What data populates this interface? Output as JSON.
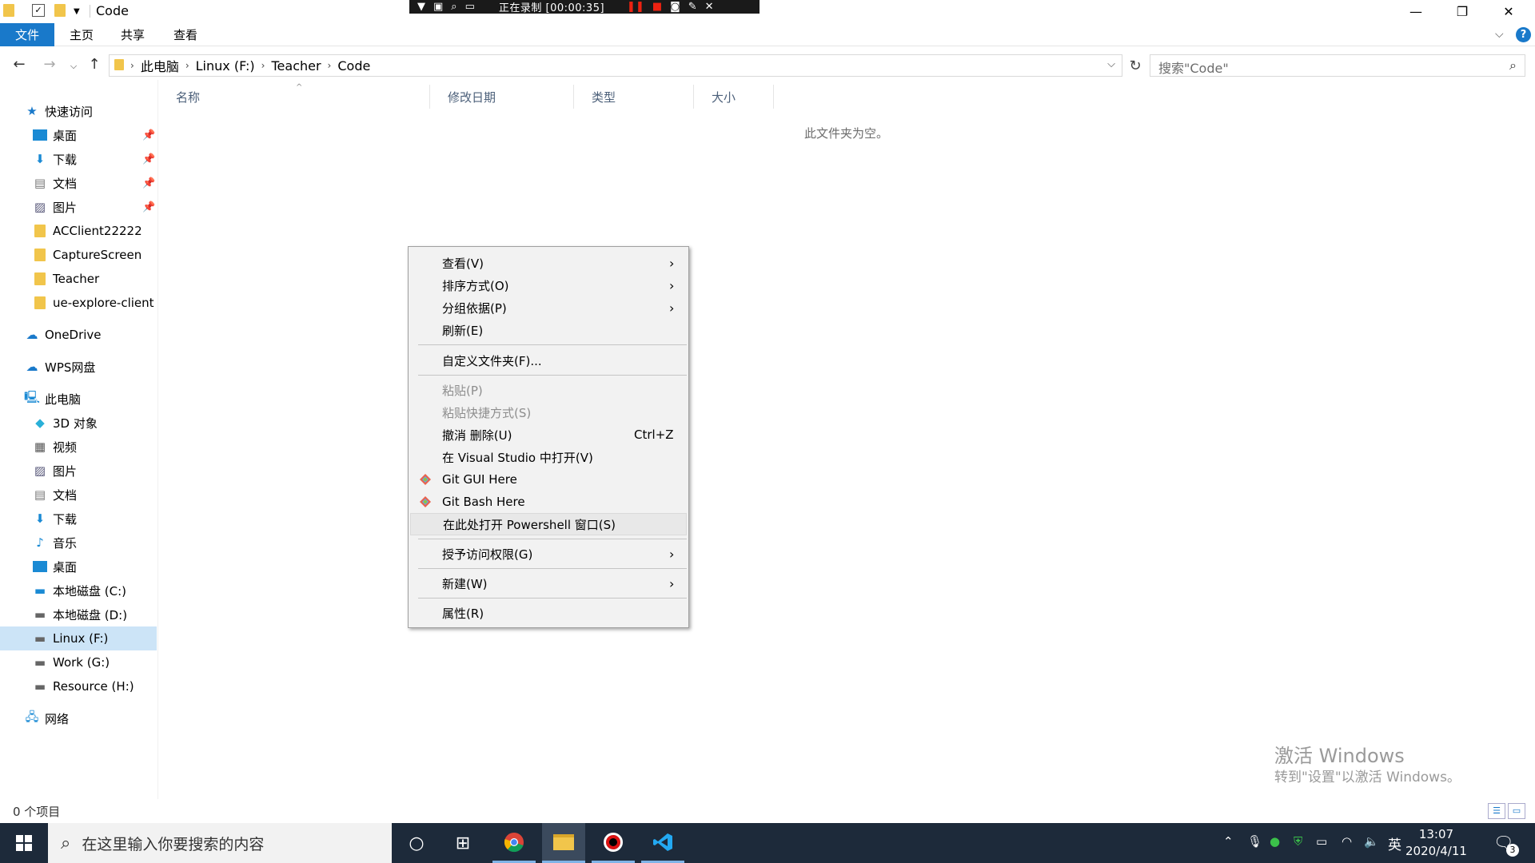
{
  "window": {
    "title": "Code",
    "minimize_label": "—",
    "restore_label": "❐",
    "close_label": "✕"
  },
  "recording_bar": {
    "text": "正在录制 [00:00:35]"
  },
  "ribbon": {
    "tabs": [
      "文件",
      "主页",
      "共享",
      "查看"
    ]
  },
  "address": {
    "crumbs": [
      "此电脑",
      "Linux (F:)",
      "Teacher",
      "Code"
    ],
    "search_placeholder": "搜索\"Code\""
  },
  "sidebar": {
    "quick_access": "快速访问",
    "quick_items": [
      {
        "label": "桌面",
        "pinned": true
      },
      {
        "label": "下载",
        "pinned": true
      },
      {
        "label": "文档",
        "pinned": true
      },
      {
        "label": "图片",
        "pinned": true
      },
      {
        "label": "ACClient22222",
        "pinned": false
      },
      {
        "label": "CaptureScreen",
        "pinned": false
      },
      {
        "label": "Teacher",
        "pinned": false
      },
      {
        "label": "ue-explore-client",
        "pinned": false
      }
    ],
    "onedrive": "OneDrive",
    "wps": "WPS网盘",
    "this_pc": "此电脑",
    "pc_items": [
      "3D 对象",
      "视频",
      "图片",
      "文档",
      "下载",
      "音乐",
      "桌面",
      "本地磁盘 (C:)",
      "本地磁盘 (D:)",
      "Linux (F:)",
      "Work (G:)",
      "Resource (H:)"
    ],
    "selected": "Linux (F:)",
    "network": "网络"
  },
  "content": {
    "columns": [
      "名称",
      "修改日期",
      "类型",
      "大小"
    ],
    "empty_message": "此文件夹为空。"
  },
  "context_menu": {
    "items": [
      {
        "label": "查看(V)",
        "submenu": true
      },
      {
        "label": "排序方式(O)",
        "submenu": true
      },
      {
        "label": "分组依据(P)",
        "submenu": true
      },
      {
        "label": "刷新(E)"
      },
      {
        "label": "自定义文件夹(F)..."
      },
      {
        "label": "粘贴(P)",
        "disabled": true
      },
      {
        "label": "粘贴快捷方式(S)",
        "disabled": true
      },
      {
        "label": "撤消 删除(U)",
        "shortcut": "Ctrl+Z"
      },
      {
        "label": "在 Visual Studio 中打开(V)"
      },
      {
        "label": "Git GUI Here",
        "icon": "git-icon"
      },
      {
        "label": "Git Bash Here",
        "icon": "git-icon"
      },
      {
        "label": "在此处打开 Powershell 窗口(S)",
        "highlighted": true
      },
      {
        "label": "授予访问权限(G)",
        "submenu": true
      },
      {
        "label": "新建(W)",
        "submenu": true
      },
      {
        "label": "属性(R)"
      }
    ]
  },
  "watermark": {
    "line1": "激活 Windows",
    "line2": "转到\"设置\"以激活 Windows。"
  },
  "status": {
    "item_count": "0 个项目"
  },
  "taskbar": {
    "search_placeholder": "在这里输入你要搜索的内容",
    "ime": "英",
    "time": "13:07",
    "date": "2020/4/11",
    "notification_count": "3"
  },
  "colors": {
    "accent": "#1979ca",
    "taskbar": "#1d2a3a",
    "selection": "#cce4f7"
  }
}
